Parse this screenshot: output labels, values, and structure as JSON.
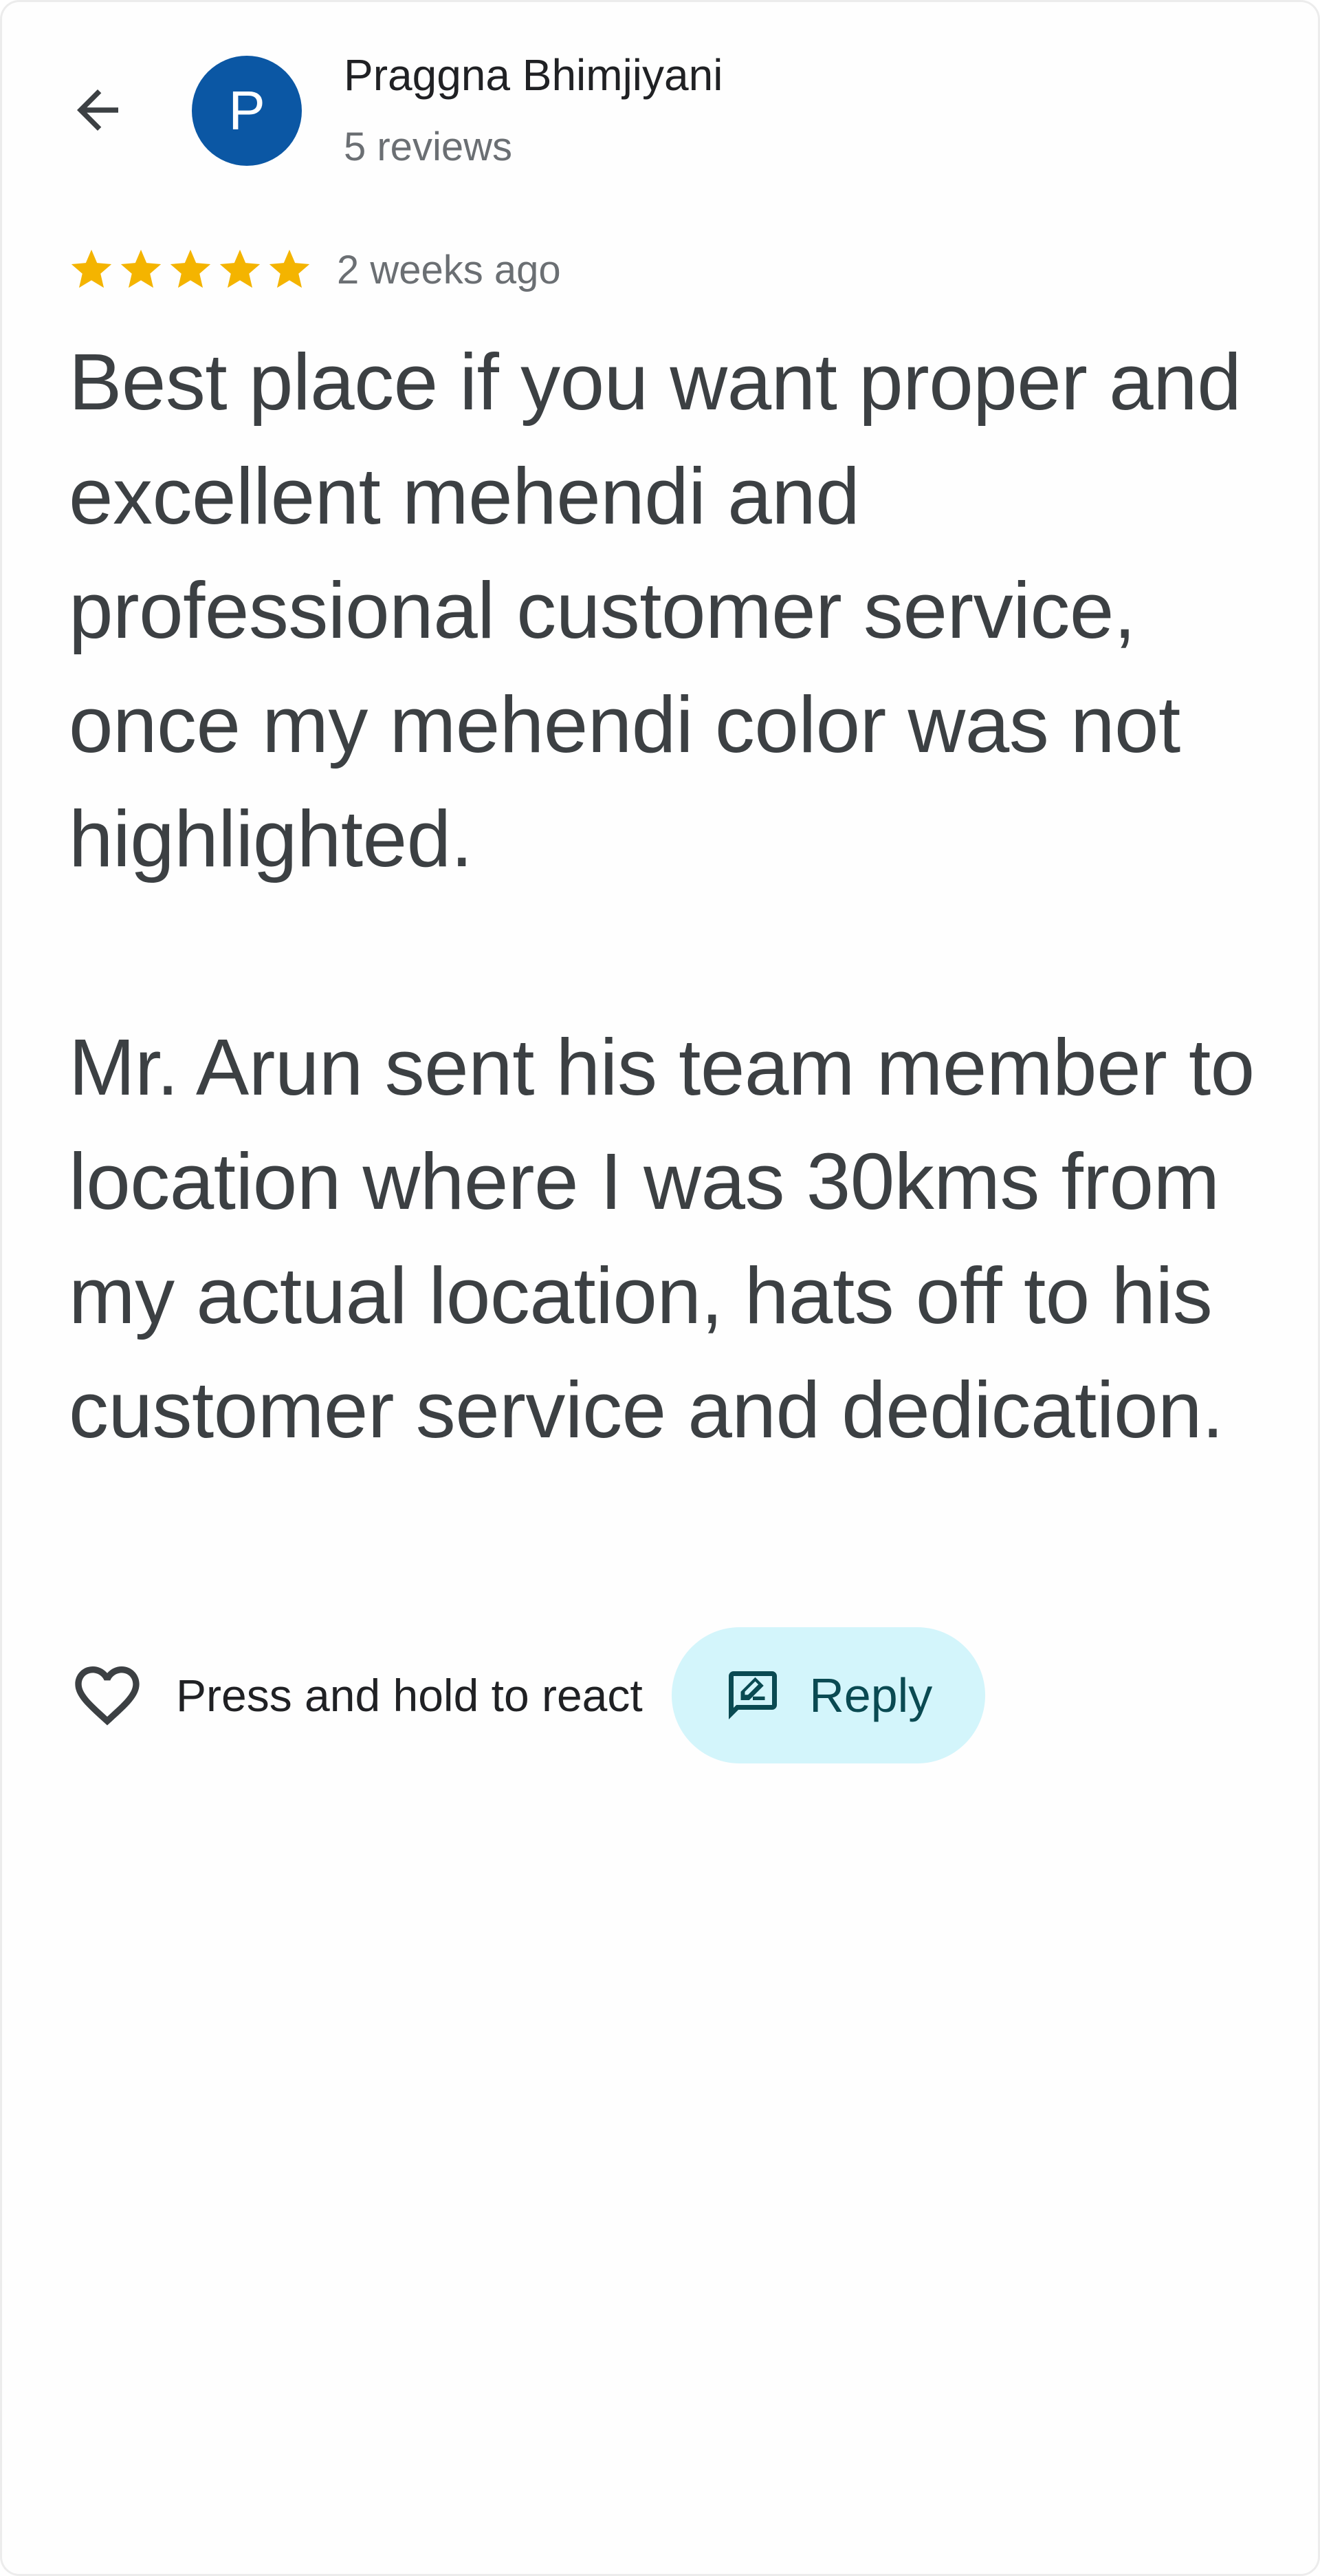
{
  "header": {
    "back_icon": "arrow-back-icon",
    "avatar_initial": "P",
    "avatar_color": "#0b57a4",
    "reviewer_name": "Praggna Bhimjiyani",
    "review_count": "5 reviews"
  },
  "review": {
    "rating": 5,
    "rating_max": 5,
    "star_color": "#f4b400",
    "time_ago": "2 weeks ago",
    "paragraphs": [
      "Best place if you want proper and excellent mehendi and professional customer service, once my mehendi color was not highlighted.",
      "Mr. Arun sent his team member to location where I was 30kms from my actual location, hats off to his customer service and dedication."
    ]
  },
  "actions": {
    "react_icon": "heart-outline-icon",
    "react_label": "Press and hold to react",
    "reply_icon": "reply-comment-icon",
    "reply_label": "Reply",
    "reply_bg_color": "#d3f5fb"
  }
}
